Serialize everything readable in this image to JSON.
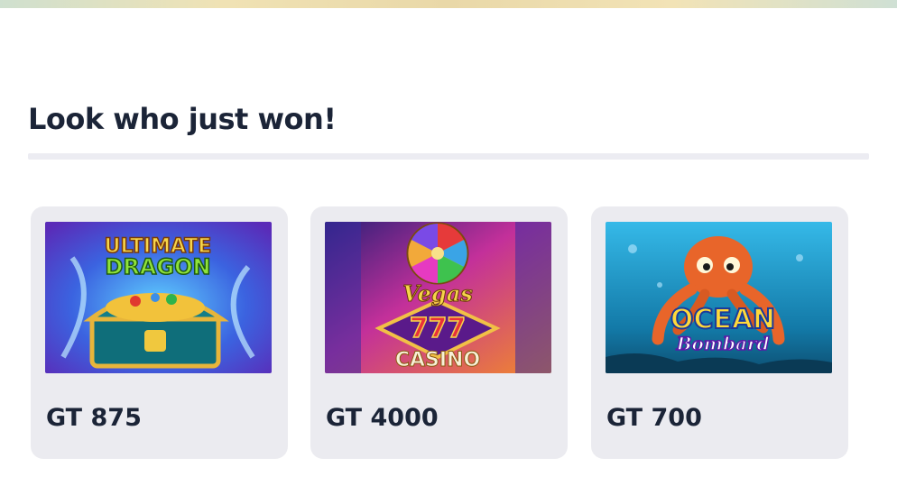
{
  "section": {
    "title": "Look who just won!"
  },
  "winners": [
    {
      "game": "Ultimate Dragon",
      "logo_line1": "ULTIMATE",
      "logo_line2": "DRAGON",
      "amount": "GT 875",
      "thumb_icon": "treasure-chest-icon"
    },
    {
      "game": "Vegas 777 Casino",
      "logo_line1": "Vegas",
      "logo_line2": "777",
      "logo_line3": "CASINO",
      "amount": "GT 4000",
      "thumb_icon": "fortune-wheel-icon"
    },
    {
      "game": "Ocean Bombard",
      "logo_line1": "OCEAN",
      "logo_line2": "Bombard",
      "amount": "GT 700",
      "thumb_icon": "octopus-icon"
    }
  ]
}
